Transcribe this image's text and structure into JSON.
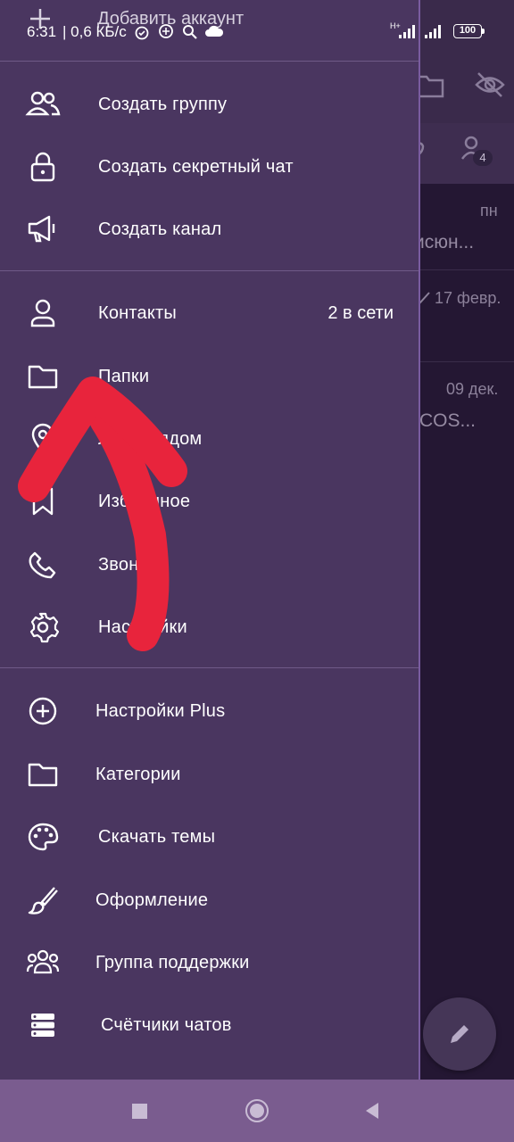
{
  "status_bar": {
    "time": "6:31",
    "network_speed": "| 0,6 КБ/с",
    "network_type": "H+",
    "battery": "100"
  },
  "drawer": {
    "add_account_label": "Добавить аккаунт",
    "group1": [
      {
        "label": "Создать группу",
        "icon": "group-icon"
      },
      {
        "label": "Создать секретный чат",
        "icon": "lock-icon"
      },
      {
        "label": "Создать канал",
        "icon": "megaphone-icon"
      }
    ],
    "group2": [
      {
        "label": "Контакты",
        "icon": "person-icon",
        "right": "2 в сети"
      },
      {
        "label": "Папки",
        "icon": "folder-icon"
      },
      {
        "label": "Люди рядом",
        "icon": "location-icon"
      },
      {
        "label": "Избранное",
        "icon": "bookmark-icon"
      },
      {
        "label": "Звонки",
        "icon": "phone-icon"
      },
      {
        "label": "Настройки",
        "icon": "gear-icon"
      }
    ],
    "group3": [
      {
        "label": "Настройки Plus",
        "icon": "plus-circle-icon"
      },
      {
        "label": "Категории",
        "icon": "folder-icon"
      },
      {
        "label": "Скачать темы",
        "icon": "palette-icon"
      },
      {
        "label": "Оформление",
        "icon": "brush-icon"
      },
      {
        "label": "Группа поддержки",
        "icon": "support-group-icon"
      },
      {
        "label": "Счётчики чатов",
        "icon": "counters-icon"
      }
    ]
  },
  "background_chats": {
    "badge_count": "4",
    "rows": [
      {
        "date": "пн",
        "preview": "исюн..."
      },
      {
        "date": "17 февр.",
        "preview": ""
      },
      {
        "date": "09 дек.",
        "preview": "COS..."
      }
    ]
  },
  "colors": {
    "drawer_bg": "#4a3660",
    "annotation_arrow": "#e8243c",
    "navbar_bg": "#7a5c8f"
  }
}
